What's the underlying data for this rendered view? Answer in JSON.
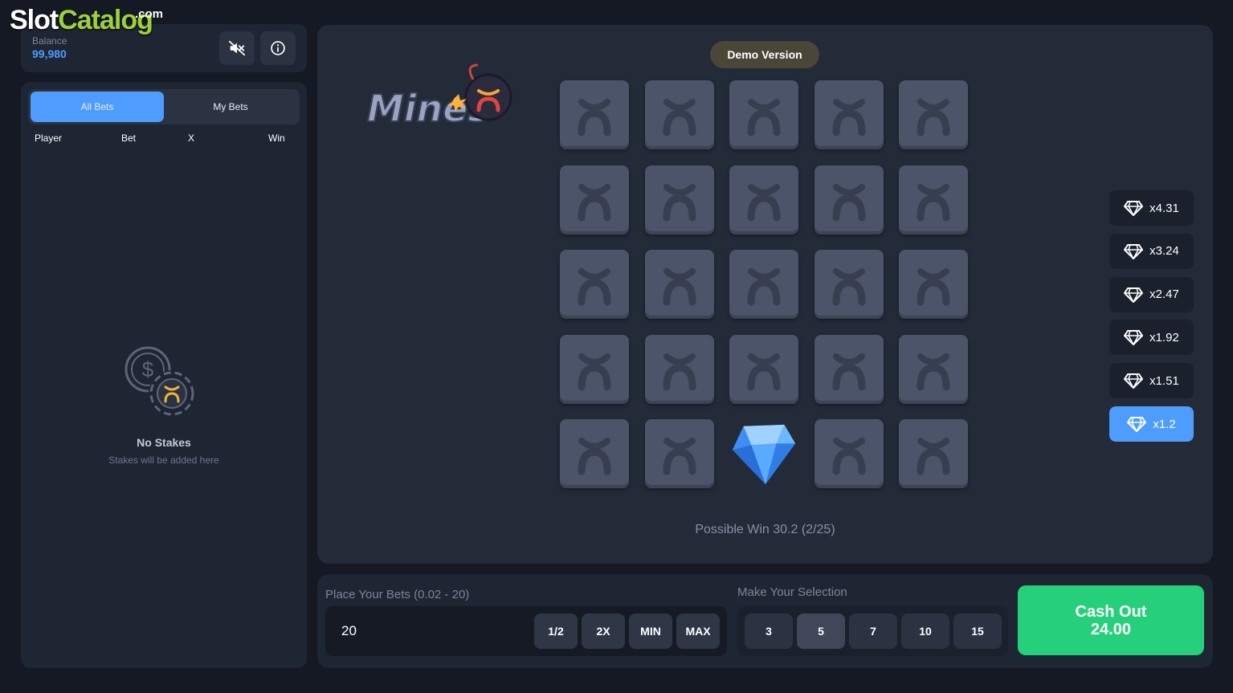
{
  "watermark": {
    "part1": "Slot",
    "part2": "Catalog",
    "part3": ".com"
  },
  "header": {
    "balance_label": "Balance",
    "balance_value": "99,980",
    "mute_icon": "speaker-muted-icon",
    "info_icon": "info-icon"
  },
  "bets_panel": {
    "tabs": [
      {
        "label": "All Bets",
        "active": true
      },
      {
        "label": "My Bets",
        "active": false
      }
    ],
    "columns": [
      "Player",
      "Bet",
      "X",
      "Win"
    ],
    "empty_title": "No Stakes",
    "empty_subtitle": "Stakes will be added here"
  },
  "game": {
    "demo_label": "Demo Version",
    "logo_text": "Mines",
    "grid_rows": 5,
    "grid_cols": 5,
    "revealed_tiles": [
      {
        "row": 4,
        "col": 2,
        "type": "gem"
      }
    ],
    "multipliers": [
      {
        "label": "x4.31",
        "active": false
      },
      {
        "label": "x3.24",
        "active": false
      },
      {
        "label": "x2.47",
        "active": false
      },
      {
        "label": "x1.92",
        "active": false
      },
      {
        "label": "x1.51",
        "active": false
      },
      {
        "label": "x1.2",
        "active": true
      }
    ],
    "possible_win": "Possible Win 30.2 (2/25)"
  },
  "controls": {
    "bets_label": "Place Your Bets (0.02 - 20)",
    "bet_value": "20",
    "bet_buttons": [
      "1/2",
      "2X",
      "MIN",
      "MAX"
    ],
    "selection_label": "Make Your Selection",
    "selection_options": [
      {
        "label": "3",
        "active": false
      },
      {
        "label": "5",
        "active": true
      },
      {
        "label": "7",
        "active": false
      },
      {
        "label": "10",
        "active": false
      },
      {
        "label": "15",
        "active": false
      }
    ],
    "cashout_label": "Cash Out",
    "cashout_value": "24.00"
  },
  "colors": {
    "accent": "#4f9cff",
    "cashout": "#26d07a",
    "tile": "#4b5468",
    "panel": "#1e2533"
  }
}
